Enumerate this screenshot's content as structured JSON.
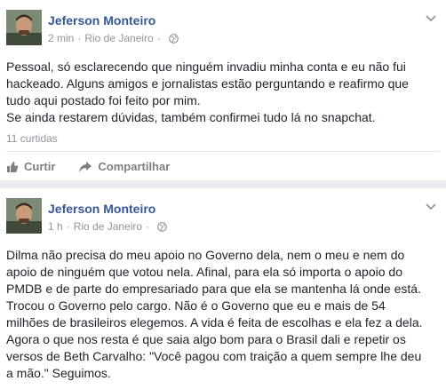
{
  "posts": [
    {
      "author": "Jeferson Monteiro",
      "time": "2 min",
      "location": "Rio de Janeiro",
      "separator": "·",
      "text": [
        "Pessoal, só esclarecendo que ninguém invadiu minha conta e eu não fui",
        "hackeado. Alguns amigos e jornalistas estão perguntando e reafirmo que",
        "tudo aqui postado foi feito por mim.",
        "Se ainda restarem dúvidas, também confirmei tudo lá no snapchat."
      ],
      "likes": "11 curtidas",
      "actions": {
        "like": "Curtir",
        "share": "Compartilhar"
      },
      "icons": [
        "globe-icon",
        "chevron-down-icon",
        "thumbs-up-icon",
        "share-arrow-icon"
      ]
    },
    {
      "author": "Jeferson Monteiro",
      "time": "1 h",
      "location": "Rio de Janeiro",
      "separator": "·",
      "text": [
        "Dilma não precisa do meu apoio no Governo dela, nem o meu e nem do",
        "apoio de ninguém que votou nela. Afinal, para ela só importa o apoio do",
        "PMDB e de parte do empresariado para que ela se mantenha lá onde está.",
        "Trocou o Governo pelo cargo. Não é o Governo que eu e mais de 54",
        "milhões de brasileiros elegemos. A vida é feita de escolhas e ela fez a dela.",
        "Agora o que nos resta é que saia algo bom para o Brasil dali e repetir os",
        "versos de Beth Carvalho: \"Você pagou com traição a quem sempre lhe deu",
        "a mão.\" Seguimos."
      ],
      "icons": [
        "globe-icon",
        "chevron-down-icon"
      ]
    }
  ],
  "colors": {
    "author": "#365899",
    "meta": "#90949c",
    "text": "#1d2129",
    "background": "#e9ebee"
  }
}
